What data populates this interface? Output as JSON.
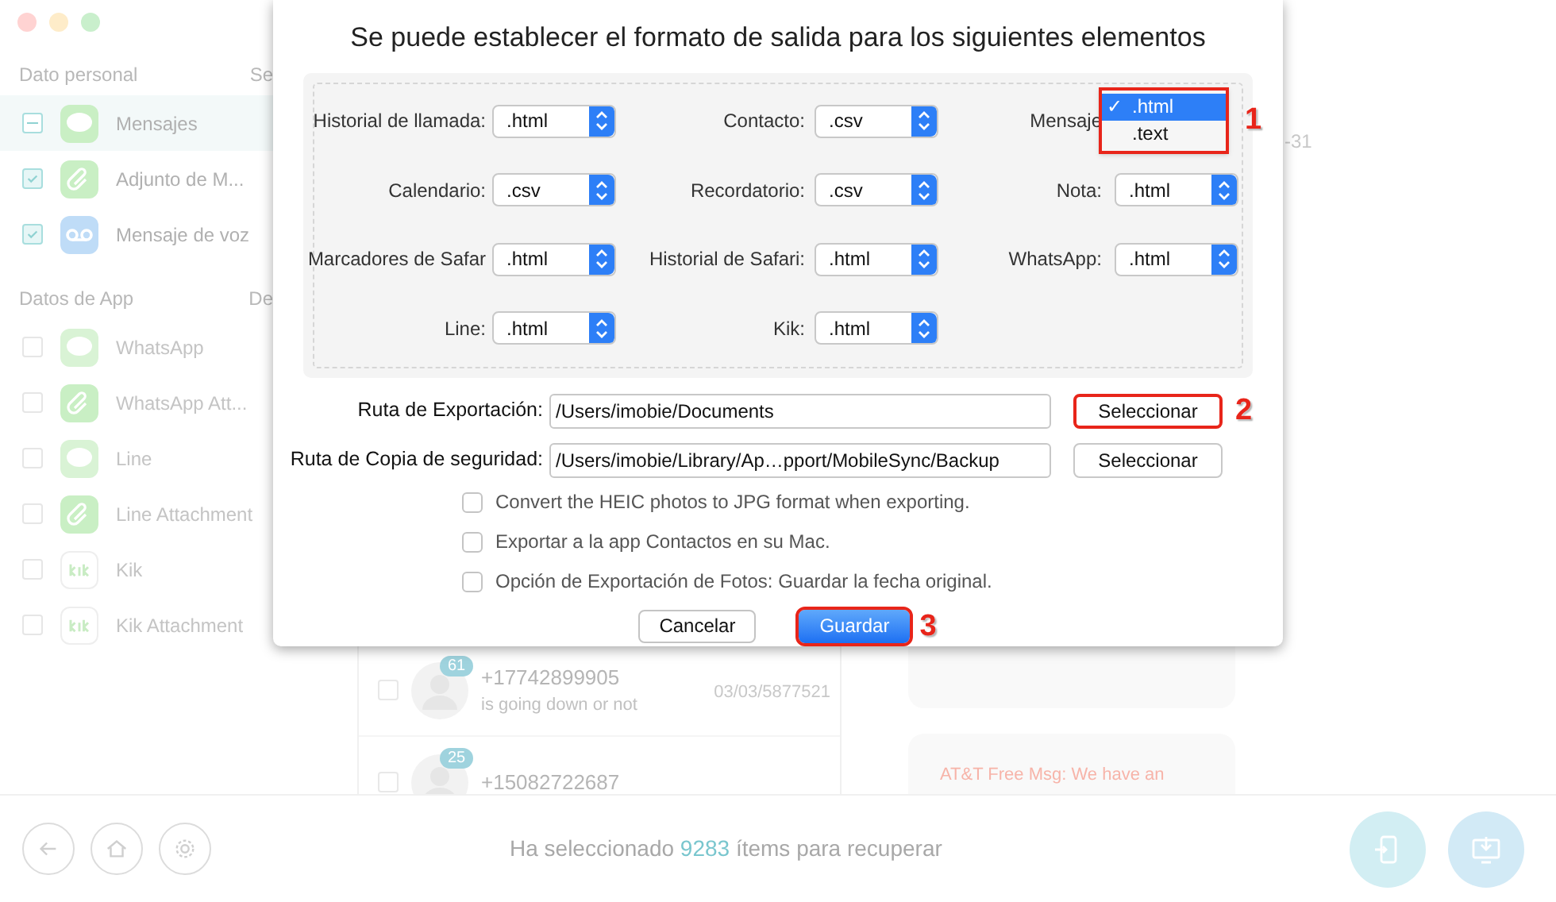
{
  "sidebar": {
    "sections": [
      {
        "title": "Dato personal",
        "column": "Se",
        "items": [
          {
            "label": "Mensajes",
            "kind": "message",
            "checked": false,
            "partial": true,
            "selected": true
          },
          {
            "label": "Adjunto de M...",
            "kind": "attachment",
            "checked": true,
            "partial": false,
            "selected": false
          },
          {
            "label": "Mensaje de voz",
            "kind": "voicemail",
            "checked": true,
            "partial": false,
            "selected": false
          }
        ]
      },
      {
        "title": "Datos de App",
        "column": "De",
        "items": [
          {
            "label": "WhatsApp",
            "kind": "whatsapp",
            "checked": false,
            "partial": false,
            "selected": false
          },
          {
            "label": "WhatsApp Att...",
            "kind": "attachment",
            "checked": false,
            "partial": false,
            "selected": false
          },
          {
            "label": "Line",
            "kind": "line",
            "checked": false,
            "partial": false,
            "selected": false
          },
          {
            "label": "Line Attachment",
            "kind": "attachment",
            "checked": false,
            "partial": false,
            "selected": false
          },
          {
            "label": "Kik",
            "kind": "kik",
            "checked": false,
            "partial": false,
            "selected": false
          },
          {
            "label": "Kik Attachment",
            "kind": "kik",
            "checked": false,
            "partial": false,
            "selected": false
          }
        ]
      }
    ]
  },
  "side_text": "-31",
  "messages": [
    {
      "badge": "61",
      "phone": "+17742899905",
      "preview": "is going down or not",
      "date": "03/03/5877521",
      "checked": false
    },
    {
      "badge": "25",
      "phone": "+15082722687",
      "checked": false
    }
  ],
  "chat": {
    "bubbles": [
      "AT&T Free Msg: We have an"
    ]
  },
  "bottom": {
    "status": {
      "before": "Ha seleccionado",
      "count": "9283",
      "after": "ítems para recuperar"
    }
  },
  "dialog": {
    "title": "Se puede establecer el formato de salida para los siguientes elementos",
    "formats": [
      [
        {
          "label": "Historial de llamada:",
          "kind": "select",
          "value": ".html"
        },
        {
          "label": "Contacto:",
          "kind": "select",
          "value": ".csv"
        },
        {
          "label": "Mensaje",
          "kind": "open",
          "check_mark": "✓",
          "options": [
            {
              "label": ".html",
              "selected": true
            },
            {
              "label": ".text",
              "selected": false
            }
          ],
          "step": "1"
        }
      ],
      [
        {
          "label": "Calendario:",
          "kind": "select",
          "value": ".csv"
        },
        {
          "label": "Recordatorio:",
          "kind": "select",
          "value": ".csv"
        },
        {
          "label": "Nota:",
          "kind": "select",
          "value": ".html"
        }
      ],
      [
        {
          "label": "Marcadores de Safar",
          "kind": "select",
          "value": ".html"
        },
        {
          "label": "Historial de Safari:",
          "kind": "select",
          "value": ".html"
        },
        {
          "label": "WhatsApp:",
          "kind": "select",
          "value": ".html"
        }
      ],
      [
        {
          "label": "Line:",
          "kind": "select",
          "value": ".html"
        },
        {
          "label": "Kik:",
          "kind": "select",
          "value": ".html"
        }
      ]
    ],
    "paths": [
      {
        "label": "Ruta de Exportación:",
        "value": "/Users/imobie/Documents",
        "button": "Seleccionar",
        "highlighted": true,
        "step": "2"
      },
      {
        "label": "Ruta de Copia de seguridad:",
        "value": "/Users/imobie/Library/Ap…pport/MobileSync/Backup",
        "button": "Seleccionar",
        "highlighted": false
      }
    ],
    "options": [
      {
        "label": "Convert the HEIC photos to JPG format when exporting.",
        "checked": false
      },
      {
        "label": "Exportar a la app Contactos en su Mac.",
        "checked": false
      },
      {
        "label": "Opción de Exportación de Fotos: Guardar la fecha original.",
        "checked": false
      }
    ],
    "buttons": [
      {
        "label": "Cancelar",
        "kind": "secondary",
        "highlighted": false
      },
      {
        "label": "Guardar",
        "kind": "primary",
        "highlighted": true,
        "step": "3"
      }
    ]
  }
}
